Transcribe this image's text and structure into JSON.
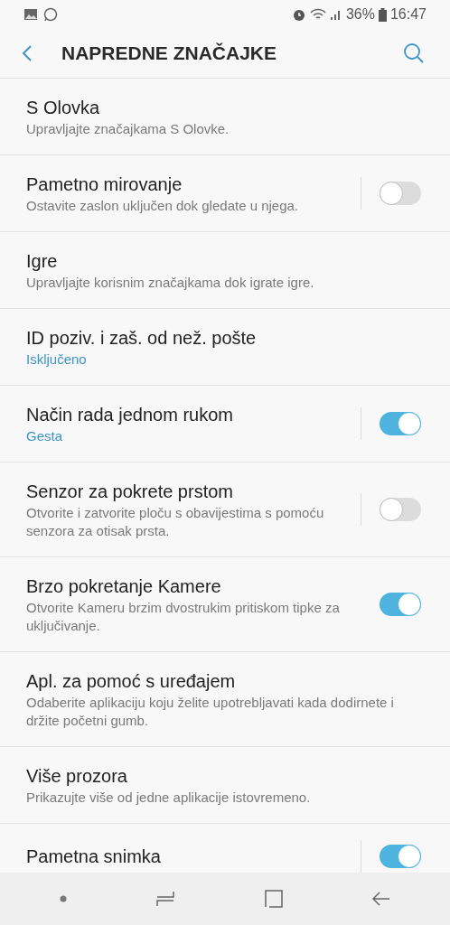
{
  "status_bar": {
    "battery": "36%",
    "time": "16:47"
  },
  "header": {
    "title": "NAPREDNE ZNAČAJKE"
  },
  "items": [
    {
      "kind": "plain",
      "title": "S Olovka",
      "subtitle": {
        "kind": "description",
        "text": "Upravljajte značajkama S Olovke."
      }
    },
    {
      "kind": "toggle",
      "title": "Pametno mirovanje",
      "subtitle": {
        "kind": "description",
        "text": "Ostavite zaslon uključen dok gledate u njega."
      },
      "on": false,
      "divider": true
    },
    {
      "kind": "plain",
      "title": "Igre",
      "subtitle": {
        "kind": "description",
        "text": "Upravljajte korisnim značajkama dok igrate igre."
      }
    },
    {
      "kind": "plain",
      "title": "ID poziv. i zaš. od než. pošte",
      "subtitle": {
        "kind": "status",
        "text": "Isključeno"
      }
    },
    {
      "kind": "toggle",
      "title": "Način rada jednom rukom",
      "subtitle": {
        "kind": "status",
        "text": "Gesta"
      },
      "on": true,
      "divider": true
    },
    {
      "kind": "toggle",
      "title": "Senzor za pokrete prstom",
      "subtitle": {
        "kind": "description",
        "text": "Otvorite i zatvorite ploču s obavijestima s pomoću senzora za otisak prsta."
      },
      "on": false,
      "divider": true
    },
    {
      "kind": "toggle",
      "title": "Brzo pokretanje Kamere",
      "subtitle": {
        "kind": "description",
        "text": "Otvorite Kameru brzim dvostrukim pritiskom tipke za uključivanje."
      },
      "on": true,
      "divider": false
    },
    {
      "kind": "plain",
      "title": "Apl. za pomoć s uređajem",
      "subtitle": {
        "kind": "description",
        "text": "Odaberite aplikaciju koju želite upotrebljavati kada dodirnete i držite početni gumb."
      }
    },
    {
      "kind": "plain",
      "title": "Više prozora",
      "subtitle": {
        "kind": "description",
        "text": "Prikazujte više od jedne aplikacije istovremeno."
      }
    },
    {
      "kind": "toggle",
      "title": "Pametna snimka",
      "on": true,
      "divider": true
    }
  ]
}
